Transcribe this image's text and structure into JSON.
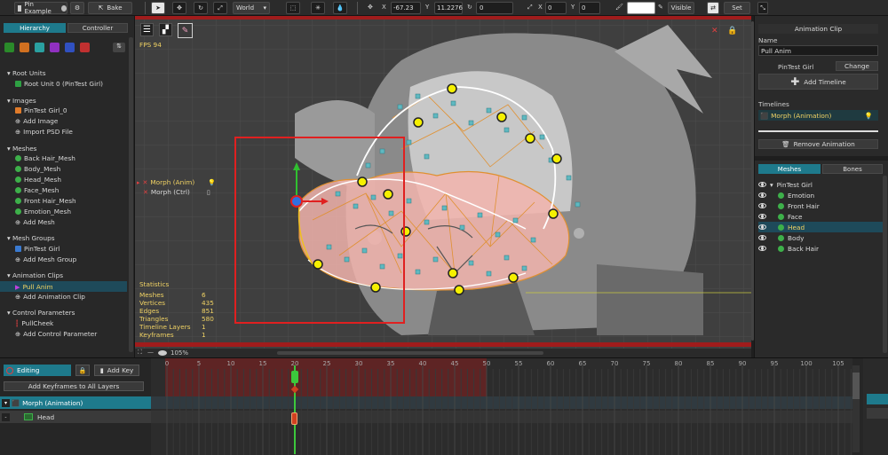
{
  "toolbar": {
    "tab_name": "Pin Example",
    "bake_label": "Bake",
    "space_select": "World",
    "pos_x_label": "X",
    "pos_x": "-67.23",
    "pos_y_label": "Y",
    "pos_y": "11.2276",
    "rot": "0",
    "scale_x_label": "X",
    "scale_x": "0",
    "scale_y_label": "Y",
    "scale_y": "0",
    "visible_label": "Visible",
    "set_label": "Set"
  },
  "left": {
    "tabs": [
      "Hierarchy",
      "Controller"
    ],
    "sections": [
      {
        "title": "Root Units",
        "items": [
          {
            "label": "Root Unit 0 (PinTest Girl)",
            "icon": "root-icon"
          }
        ]
      },
      {
        "title": "Images",
        "items": [
          {
            "label": "PinTest Girl_0",
            "icon": "image-icon"
          },
          {
            "label": "Add Image",
            "icon": "add-icon"
          },
          {
            "label": "Import PSD File",
            "icon": "add-icon"
          }
        ]
      },
      {
        "title": "Meshes",
        "items": [
          {
            "label": "Back Hair_Mesh",
            "icon": "mesh-icon"
          },
          {
            "label": "Body_Mesh",
            "icon": "mesh-icon"
          },
          {
            "label": "Head_Mesh",
            "icon": "mesh-icon"
          },
          {
            "label": "Face_Mesh",
            "icon": "mesh-icon"
          },
          {
            "label": "Front Hair_Mesh",
            "icon": "mesh-icon"
          },
          {
            "label": "Emotion_Mesh",
            "icon": "mesh-icon"
          },
          {
            "label": "Add Mesh",
            "icon": "add-icon"
          }
        ]
      },
      {
        "title": "Mesh Groups",
        "items": [
          {
            "label": "PinTest Girl",
            "icon": "group-icon"
          },
          {
            "label": "Add Mesh Group",
            "icon": "add-icon"
          }
        ]
      },
      {
        "title": "Animation Clips",
        "items": [
          {
            "label": "Pull Anim",
            "icon": "anim-icon",
            "selected": true
          },
          {
            "label": "Add Animation Clip",
            "icon": "add-icon"
          }
        ]
      },
      {
        "title": "Control Parameters",
        "items": [
          {
            "label": "PullCheek",
            "icon": "param-icon"
          },
          {
            "label": "Add Control Parameter",
            "icon": "add-icon"
          }
        ]
      }
    ]
  },
  "viewport": {
    "fps": "FPS 94",
    "morph_anim": "Morph (Anim)",
    "morph_ctrl": "Morph (Ctrl)",
    "zoom": "105%",
    "stats_title": "Statistics",
    "stats": [
      {
        "label": "Meshes",
        "value": "6"
      },
      {
        "label": "Vertices",
        "value": "435"
      },
      {
        "label": "Edges",
        "value": "851"
      },
      {
        "label": "Triangles",
        "value": "580"
      },
      {
        "label": "Timeline Layers",
        "value": "1"
      },
      {
        "label": "Keyframes",
        "value": "1"
      }
    ]
  },
  "right": {
    "header": "Animation Clip",
    "name_label": "Name",
    "name_value": "Pull Anim",
    "target_label": "PinTest Girl",
    "change_label": "Change",
    "add_timeline_label": "Add Timeline",
    "timelines_label": "Timelines",
    "timeline_item": "Morph (Animation)",
    "remove_label": "Remove Animation",
    "tabs": [
      "Meshes",
      "Bones"
    ],
    "root_layer": "PinTest Girl",
    "layers": [
      "Emotion",
      "Front Hair",
      "Face",
      "Head",
      "Body",
      "Back Hair"
    ],
    "selected_layer": "Head"
  },
  "timeline": {
    "editing_label": "Editing",
    "add_key_label": "Add Key",
    "add_keyframes_label": "Add Keyframes to All Layers",
    "ticks": [
      "0",
      "5",
      "10",
      "15",
      "20",
      "25",
      "30",
      "35",
      "40",
      "45",
      "50",
      "55",
      "60",
      "65",
      "70",
      "75",
      "80",
      "85",
      "90",
      "95",
      "100",
      "105"
    ],
    "current_frame": 20,
    "rows": [
      {
        "label": "Morph (Animation)"
      },
      {
        "label": "Head"
      }
    ]
  },
  "colors": {
    "accent_teal": "#1e7a8c",
    "selection_yellow": "#f0d264",
    "keyframe_red": "#d04020"
  }
}
